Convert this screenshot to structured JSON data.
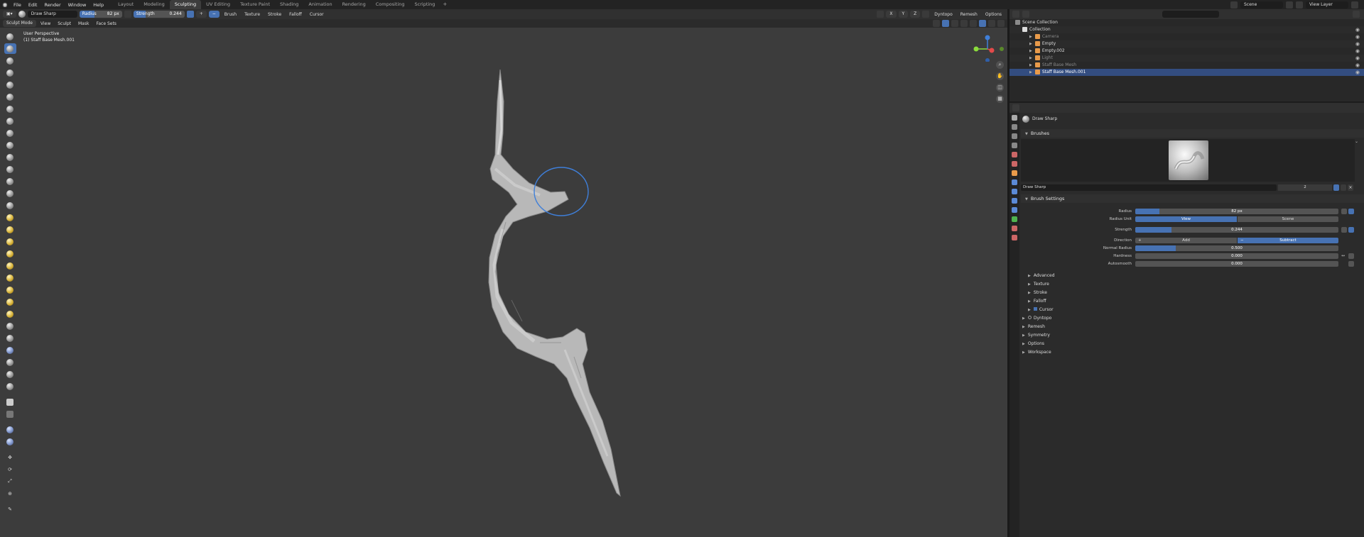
{
  "menubar": {
    "items": [
      "File",
      "Edit",
      "Render",
      "Window",
      "Help"
    ],
    "workspaces": [
      "Layout",
      "Modeling",
      "Sculpting",
      "UV Editing",
      "Texture Paint",
      "Shading",
      "Animation",
      "Rendering",
      "Compositing",
      "Scripting"
    ],
    "active_workspace": "Sculpting",
    "plus": "+",
    "scene": "Scene",
    "view_layer": "View Layer"
  },
  "toolheader": {
    "brush_name": "Draw Sharp",
    "radius_label": "Radius",
    "radius_value": "82 px",
    "strength_label": "Strength",
    "strength_value": "0.244",
    "strength_fraction": 0.244,
    "menus": [
      "Brush",
      "Texture",
      "Stroke",
      "Falloff",
      "Cursor"
    ],
    "axes": [
      "X",
      "Y",
      "Z"
    ],
    "dyntopo": "Dyntopo",
    "remesh": "Remesh",
    "options": "Options"
  },
  "viewheader": {
    "mode": "Sculpt Mode",
    "menus": [
      "View",
      "Sculpt",
      "Mask",
      "Face Sets"
    ]
  },
  "viewport": {
    "perspective": "User Perspective",
    "object": "(1) Staff Base Mesh.001"
  },
  "outliner": {
    "root": "Scene Collection",
    "collection": "Collection",
    "items": [
      {
        "name": "Camera",
        "color": "#e89a4a",
        "dim": true
      },
      {
        "name": "Empty",
        "color": "#e89a4a",
        "dim": false
      },
      {
        "name": "Empty.002",
        "color": "#e89a4a",
        "dim": false
      },
      {
        "name": "Light",
        "color": "#e89a4a",
        "dim": true
      },
      {
        "name": "Staff Base Mesh",
        "color": "#e89a4a",
        "dim": true
      },
      {
        "name": "Staff Base Mesh.001",
        "color": "#e89a4a",
        "dim": false,
        "selected": true
      }
    ]
  },
  "properties": {
    "tool_title": "Draw Sharp",
    "brushes_panel": "Brushes",
    "brush_field": "Draw Sharp",
    "brush_users": "2",
    "brush_settings_panel": "Brush Settings",
    "radius_label": "Radius",
    "radius_value": "82 px",
    "radius_fraction": 0.12,
    "radius_unit_label": "Radius Unit",
    "radius_unit_options": [
      "View",
      "Scene"
    ],
    "strength_label": "Strength",
    "strength_value": "0.244",
    "strength_fraction": 0.18,
    "direction_label": "Direction",
    "direction_options": [
      "Add",
      "Subtract"
    ],
    "normal_radius_label": "Normal Radius",
    "normal_radius_value": "0.500",
    "normal_radius_fraction": 0.2,
    "hardness_label": "Hardness",
    "hardness_value": "0.000",
    "autosmooth_label": "Autosmooth",
    "autosmooth_value": "0.000",
    "subpanels": [
      "Advanced",
      "Texture",
      "Stroke",
      "Falloff",
      "Cursor"
    ],
    "panels": [
      "Dyntopo",
      "Remesh",
      "Symmetry",
      "Options",
      "Workspace"
    ]
  },
  "colors": {
    "accent": "#4772b3",
    "viewport_bg": "#3c3c3c",
    "brush_cursor": "#3f7fd9"
  }
}
